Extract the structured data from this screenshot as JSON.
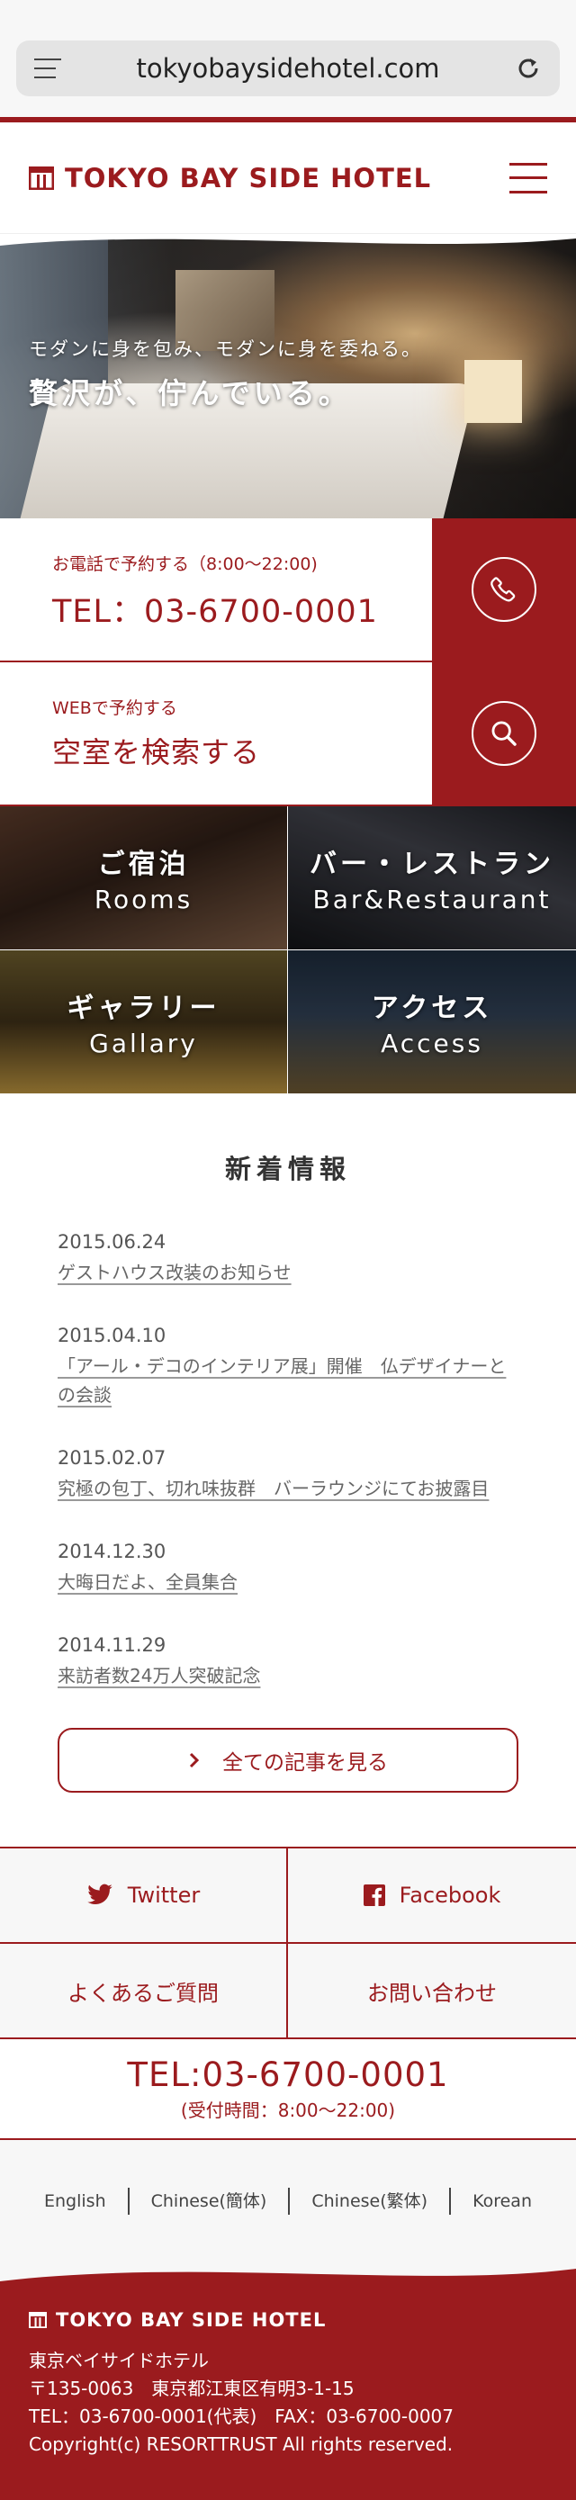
{
  "browser": {
    "url": "tokyobaysidehotel.com"
  },
  "header": {
    "logo_text": "TOKYO BAY SIDE HOTEL"
  },
  "hero": {
    "subtitle": "モダンに身を包み、モダンに身を委ねる。",
    "title": "贅沢が、佇んでいる。"
  },
  "reservation": {
    "phone": {
      "label": "お電話で予約する（8:00〜22:00)",
      "value": "TEL：03-6700-0001"
    },
    "web": {
      "label": "WEBで予約する",
      "value": "空室を検索する"
    }
  },
  "tiles": [
    {
      "title": "ご宿泊",
      "sub": "Rooms"
    },
    {
      "title": "バー・レストラン",
      "sub": "Bar&Restaurant"
    },
    {
      "title": "ギャラリー",
      "sub": "Gallary"
    },
    {
      "title": "アクセス",
      "sub": "Access"
    }
  ],
  "news": {
    "heading": "新着情報",
    "items": [
      {
        "date": "2015.06.24",
        "title": "ゲストハウス改装のお知らせ"
      },
      {
        "date": "2015.04.10",
        "title": "「アール・デコのインテリア展」開催　仏デザイナーとの会談"
      },
      {
        "date": "2015.02.07",
        "title": "究極の包丁、切れ味抜群　バーラウンジにてお披露目"
      },
      {
        "date": "2014.12.30",
        "title": "大晦日だよ、全員集合"
      },
      {
        "date": "2014.11.29",
        "title": "来訪者数24万人突破記念"
      }
    ],
    "all_button": "全ての記事を見る"
  },
  "links": {
    "twitter": "Twitter",
    "facebook": "Facebook",
    "faq": "よくあるご質問",
    "contact": "お問い合わせ"
  },
  "tel_bar": {
    "number": "TEL:03-6700-0001",
    "hours": "(受付時間：8:00〜22:00)"
  },
  "languages": [
    "English",
    "Chinese(簡体)",
    "Chinese(繁体)",
    "Korean"
  ],
  "footer": {
    "logo_text": "TOKYO BAY SIDE HOTEL",
    "name": "東京ベイサイドホテル",
    "address": "〒135-0063　東京都江東区有明3-1-15",
    "tel_fax": "TEL：03-6700-0001(代表)　FAX：03-6700-0007",
    "copyright": "Copyright(c) RESORTTRUST All rights reserved."
  },
  "colors": {
    "brand_red": "#9b1b1e",
    "bar_bg": "#f7f7f7"
  }
}
